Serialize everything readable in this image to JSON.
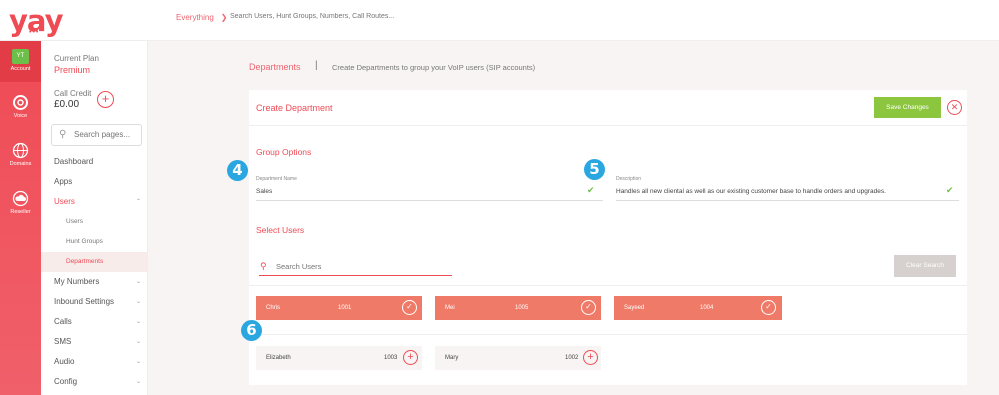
{
  "brand": {
    "logo_text": "yay",
    "logo_dots": "•••"
  },
  "topbar": {
    "scope_label": "Everything",
    "search_placeholder": "Search Users, Hunt Groups, Numbers, Call Routes..."
  },
  "rail": [
    {
      "label": "Account",
      "badge": "YT"
    },
    {
      "label": "Voice"
    },
    {
      "label": "Domains"
    },
    {
      "label": "Reseller"
    }
  ],
  "sidebar": {
    "plan_label": "Current Plan",
    "plan_value": "Premium",
    "credit_label": "Call Credit",
    "credit_value": "£0.00",
    "search_placeholder": "Search pages...",
    "items": [
      {
        "label": "Dashboard"
      },
      {
        "label": "Apps"
      },
      {
        "label": "Users"
      },
      {
        "label": "Users"
      },
      {
        "label": "Hunt Groups"
      },
      {
        "label": "Departments"
      },
      {
        "label": "My Numbers"
      },
      {
        "label": "Inbound Settings"
      },
      {
        "label": "Calls"
      },
      {
        "label": "SMS"
      },
      {
        "label": "Audio"
      },
      {
        "label": "Config"
      }
    ]
  },
  "header": {
    "breadcrumb": "Departments",
    "separator": "|",
    "description": "Create Departments to group your VoIP users (SIP accounts)"
  },
  "card": {
    "title": "Create Department",
    "save_label": "Save Changes",
    "close_symbol": "✕",
    "group_options_title": "Group Options",
    "name_label": "Department Name",
    "name_value": "Sales",
    "desc_label": "Description",
    "desc_value": "Handles all new cliental as well as our existing customer base to handle orders and upgrades.",
    "select_users_title": "Select Users",
    "user_search_placeholder": "Search Users",
    "clear_label": "Clear Search"
  },
  "steps": [
    "4",
    "5",
    "6"
  ],
  "selected_users": [
    {
      "name": "Chris",
      "ext": "1001"
    },
    {
      "name": "Mei",
      "ext": "1005"
    },
    {
      "name": "Sayeed",
      "ext": "1004"
    }
  ],
  "available_users": [
    {
      "name": "Elizabeth",
      "ext": "1003"
    },
    {
      "name": "Mary",
      "ext": "1002"
    }
  ],
  "colors": {
    "brand": "#ef4b55",
    "accent_blue": "#2aa7e0",
    "save_green": "#8cc63f",
    "chip_selected": "#f07a68"
  }
}
